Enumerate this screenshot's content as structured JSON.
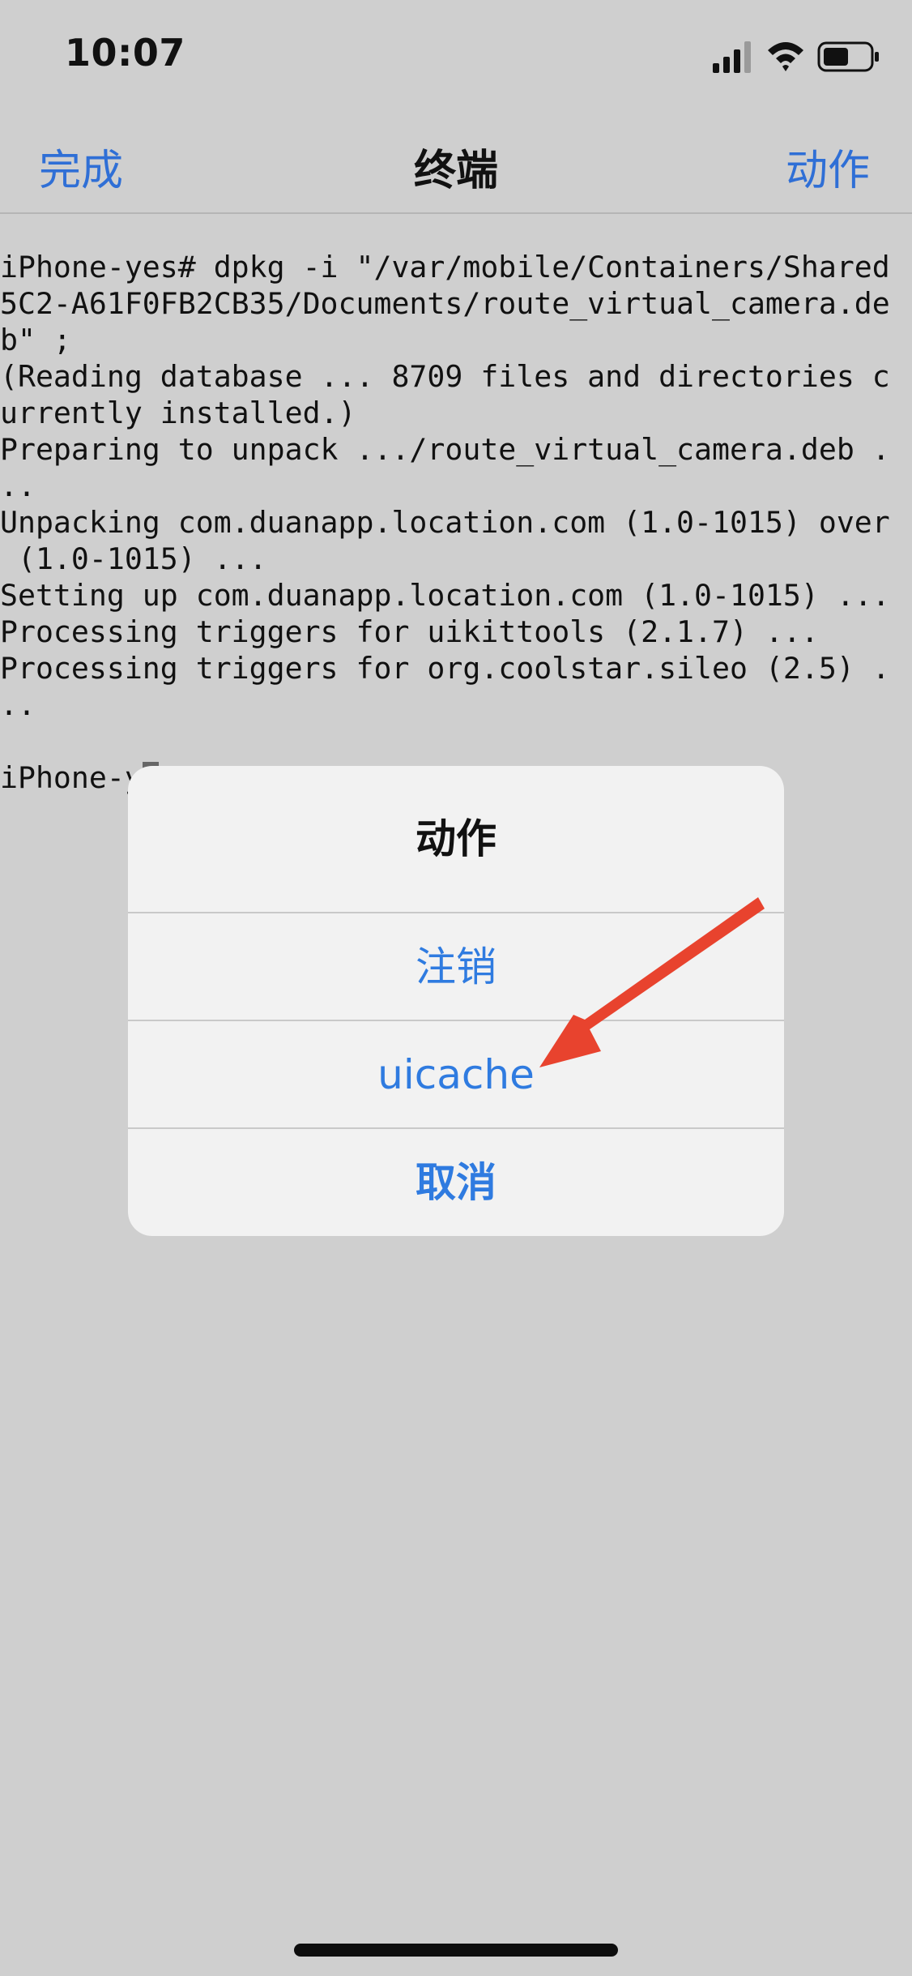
{
  "status_bar": {
    "time": "10:07",
    "signal_icon": "cellular-signal-icon",
    "wifi_icon": "wifi-icon",
    "battery_icon": "battery-icon"
  },
  "nav": {
    "left_label": "完成",
    "title": "终端",
    "right_label": "动作"
  },
  "terminal": {
    "lines": [
      "iPhone-yes# dpkg -i \"/var/mobile/Containers/Shared",
      "5C2-A61F0FB2CB35/Documents/route_virtual_camera.de",
      "b\" ;",
      "(Reading database ... 8709 files and directories c",
      "urrently installed.)",
      "Preparing to unpack .../route_virtual_camera.deb .",
      "..",
      "Unpacking com.duanapp.location.com (1.0-1015) over",
      " (1.0-1015) ...",
      "Setting up com.duanapp.location.com (1.0-1015) ...",
      "Processing triggers for uikittools (2.1.7) ...",
      "Processing triggers for org.coolstar.sileo (2.5) .",
      "..",
      ""
    ],
    "prompt_visible": "iPhone-y"
  },
  "dialog": {
    "title": "动作",
    "buttons": [
      {
        "label": "注销"
      },
      {
        "label": "uicache"
      },
      {
        "label": "取消"
      }
    ]
  },
  "annotation": {
    "arrow_color": "#e8432e"
  },
  "colors": {
    "accent": "#2f6fd6",
    "background": "#cfcfcf",
    "dialog_background": "#f2f2f2"
  }
}
